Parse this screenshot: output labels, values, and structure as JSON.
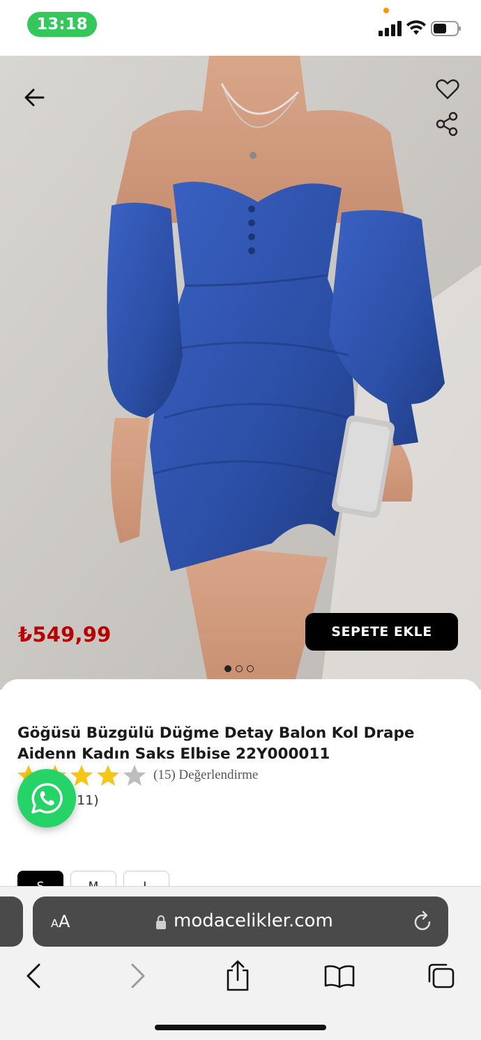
{
  "status_bar": {
    "time": "13:18"
  },
  "product": {
    "price": "₺549,99",
    "add_to_cart_label": "SEPETE EKLE",
    "title": "Göğüsü Büzgülü Düğme Detay Balon Kol Drape Aidenn Kadın Saks Elbise 22Y000011",
    "rating": {
      "stars": 4,
      "max_stars": 5,
      "label": "(15) Değerlendirme"
    },
    "sku_fragment": "011)",
    "image_page": {
      "current": 1,
      "total": 3
    },
    "sizes": [
      {
        "label": "S",
        "selected": true
      },
      {
        "label": "M",
        "selected": false
      },
      {
        "label": "L",
        "selected": false
      }
    ]
  },
  "icons": {
    "back": "arrow-left-icon",
    "favorite": "heart-icon",
    "share": "share-icon",
    "whatsapp": "whatsapp-icon"
  },
  "browser": {
    "aa_label": "AA",
    "url": "modacelikler.com"
  },
  "colors": {
    "price": "#b80000",
    "dress": "#2c4fa6",
    "star_filled": "#f5c518",
    "star_empty": "#bdbdbd",
    "whatsapp": "#25d366",
    "time_pill": "#34c759"
  }
}
